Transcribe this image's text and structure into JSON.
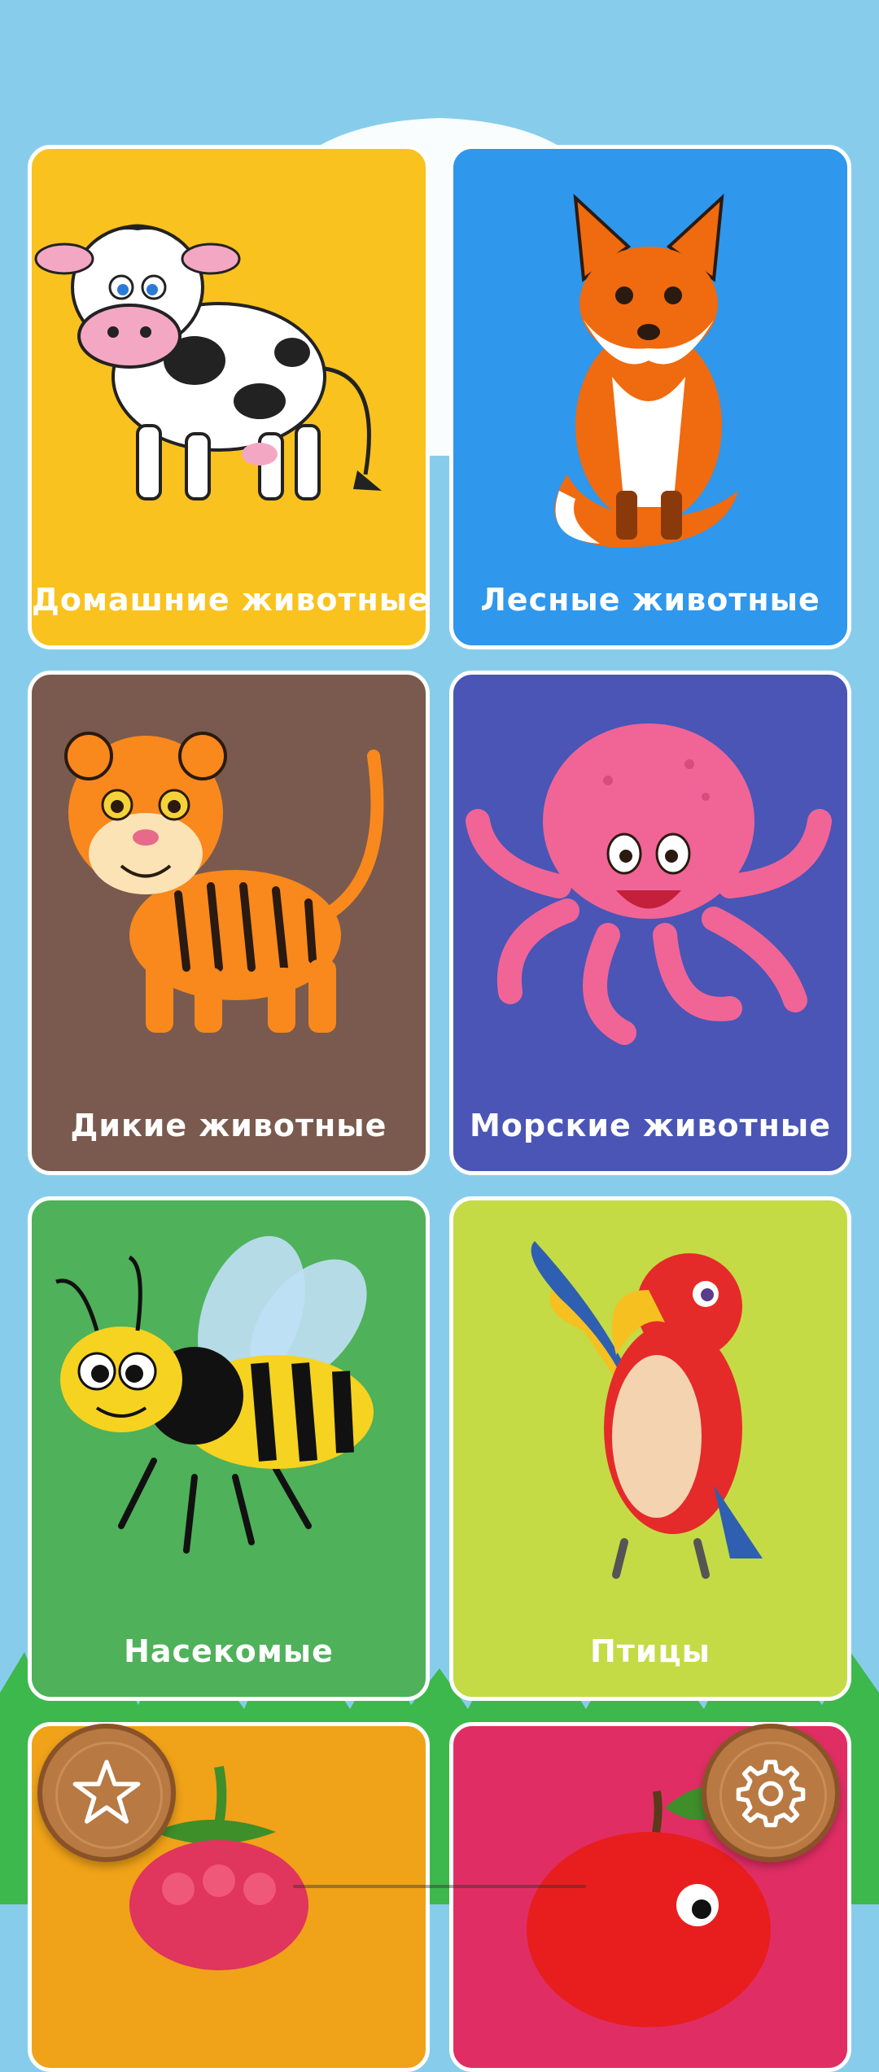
{
  "app": {
    "categories": [
      {
        "id": "domestic",
        "label": "Домашние животные",
        "color": "#F9C21E",
        "animal_icon": "cow-icon"
      },
      {
        "id": "forest",
        "label": "Лесные животные",
        "color": "#2F97EC",
        "animal_icon": "fox-icon"
      },
      {
        "id": "wild",
        "label": "Дикие животные",
        "color": "#7A5A4E",
        "animal_icon": "tiger-icon"
      },
      {
        "id": "sea",
        "label": "Морские животные",
        "color": "#4A55B6",
        "animal_icon": "octopus-icon"
      },
      {
        "id": "insects",
        "label": "Насекомые",
        "color": "#4FB15A",
        "animal_icon": "bee-icon"
      },
      {
        "id": "birds",
        "label": "Птицы",
        "color": "#C4DB45",
        "animal_icon": "parrot-icon"
      },
      {
        "id": "berries",
        "label": "",
        "color": "#F0A218",
        "animal_icon": "raspberry-icon"
      },
      {
        "id": "fruits",
        "label": "",
        "color": "#E02E64",
        "animal_icon": "apple-icon"
      }
    ],
    "buttons": {
      "favorites_icon": "star-icon",
      "settings_icon": "gear-icon"
    },
    "colors": {
      "sky": "#87CDEB",
      "grass": "#3DB84C",
      "wood": "#B87942"
    }
  }
}
